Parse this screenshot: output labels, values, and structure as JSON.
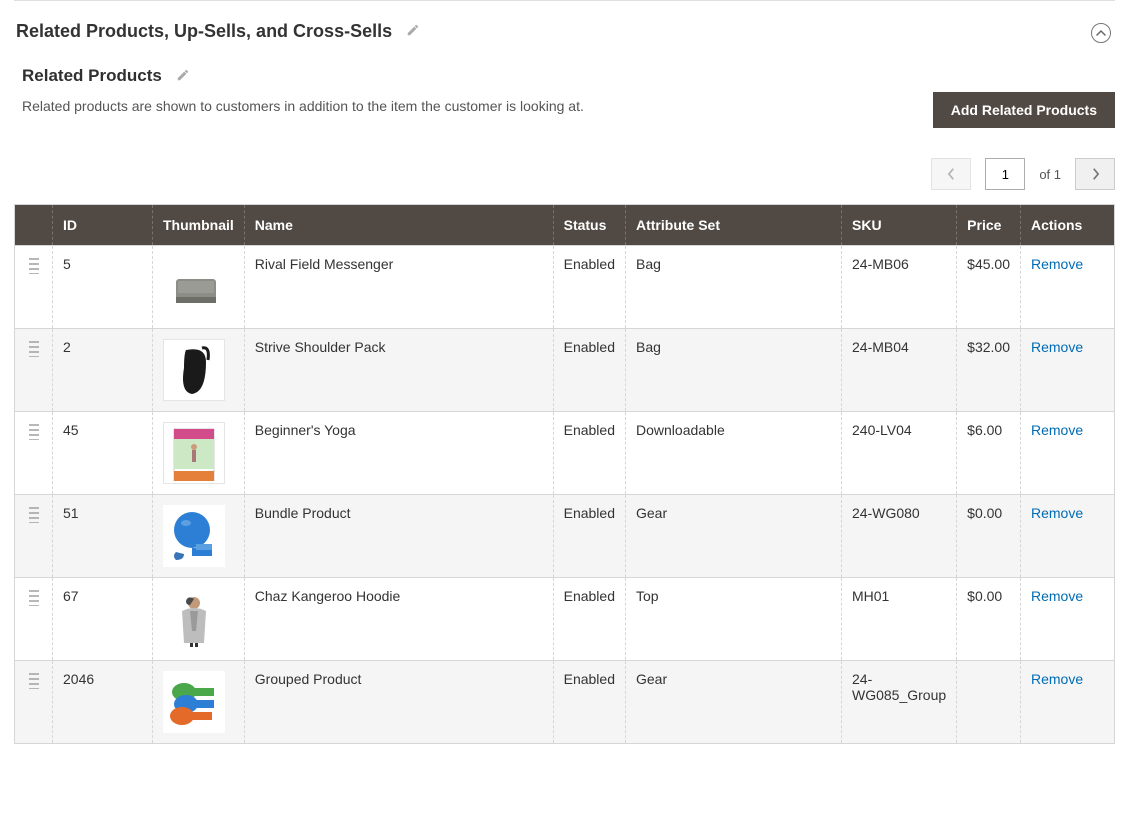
{
  "section": {
    "main_title": "Related Products, Up-Sells, and Cross-Sells",
    "sub_title": "Related Products",
    "description": "Related products are shown to customers in addition to the item the customer is looking at.",
    "add_button": "Add Related Products"
  },
  "pager": {
    "current": "1",
    "of_label": "of 1"
  },
  "columns": {
    "drag": "",
    "id": "ID",
    "thumb": "Thumbnail",
    "name": "Name",
    "status": "Status",
    "attr": "Attribute Set",
    "sku": "SKU",
    "price": "Price",
    "actions": "Actions"
  },
  "action_label": "Remove",
  "rows": [
    {
      "id": "5",
      "name": "Rival Field Messenger",
      "status": "Enabled",
      "attr": "Bag",
      "sku": "24-MB06",
      "price": "$45.00"
    },
    {
      "id": "2",
      "name": "Strive Shoulder Pack",
      "status": "Enabled",
      "attr": "Bag",
      "sku": "24-MB04",
      "price": "$32.00"
    },
    {
      "id": "45",
      "name": "Beginner's Yoga",
      "status": "Enabled",
      "attr": "Downloadable",
      "sku": "240-LV04",
      "price": "$6.00"
    },
    {
      "id": "51",
      "name": "Bundle Product",
      "status": "Enabled",
      "attr": "Gear",
      "sku": "24-WG080",
      "price": "$0.00"
    },
    {
      "id": "67",
      "name": "Chaz Kangeroo Hoodie",
      "status": "Enabled",
      "attr": "Top",
      "sku": "MH01",
      "price": "$0.00"
    },
    {
      "id": "2046",
      "name": "Grouped Product",
      "status": "Enabled",
      "attr": "Gear",
      "sku": "24-WG085_Group",
      "price": ""
    }
  ]
}
